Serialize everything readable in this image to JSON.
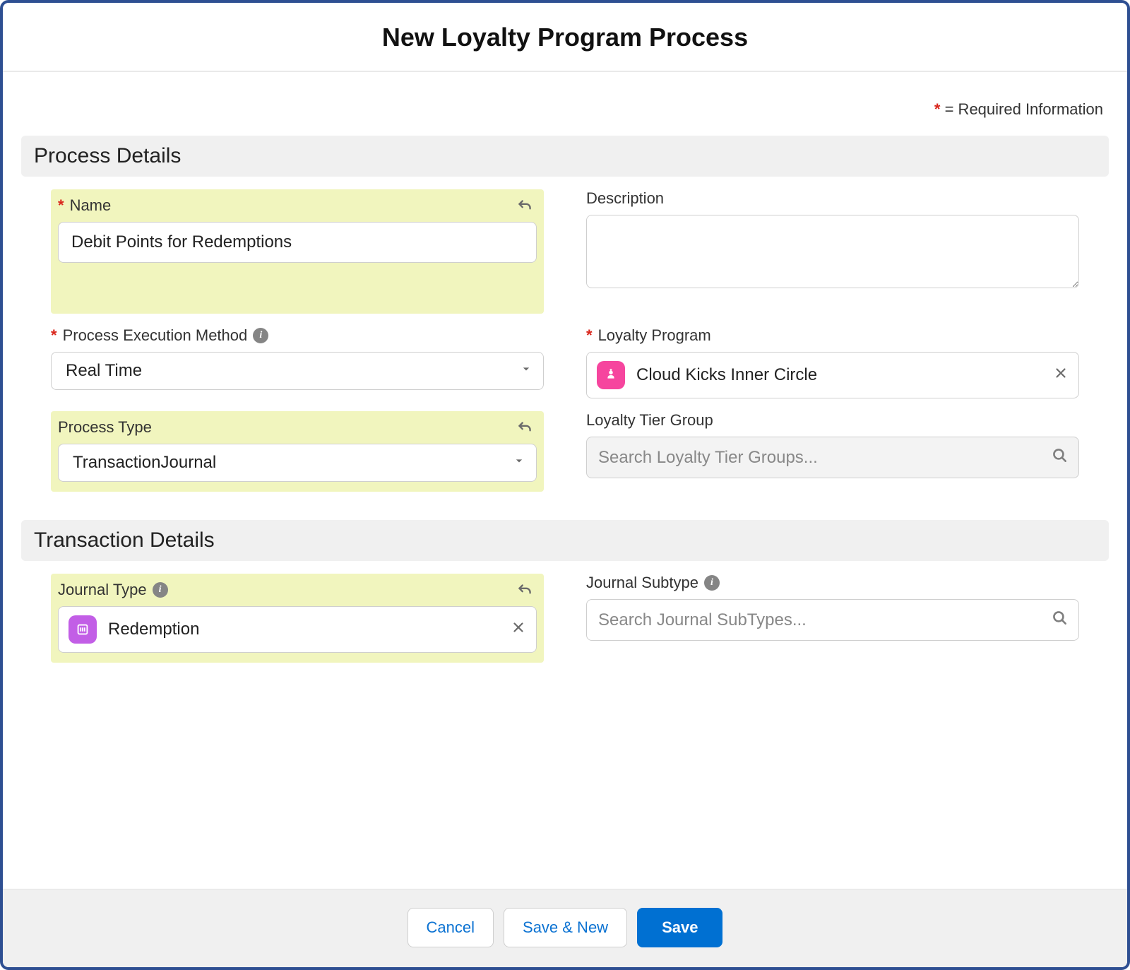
{
  "title": "New Loyalty Program Process",
  "required_note": "= Required Information",
  "sections": {
    "process": "Process Details",
    "transaction": "Transaction Details"
  },
  "fields": {
    "name": {
      "label": "Name",
      "value": "Debit Points for Redemptions",
      "required": true
    },
    "description": {
      "label": "Description",
      "value": ""
    },
    "exec_method": {
      "label": "Process Execution Method",
      "value": "Real Time",
      "required": true
    },
    "loyalty_program": {
      "label": "Loyalty Program",
      "value": "Cloud Kicks Inner Circle",
      "required": true
    },
    "process_type": {
      "label": "Process Type",
      "value": "TransactionJournal"
    },
    "tier_group": {
      "label": "Loyalty Tier Group",
      "placeholder": "Search Loyalty Tier Groups..."
    },
    "journal_type": {
      "label": "Journal Type",
      "value": "Redemption"
    },
    "journal_subtype": {
      "label": "Journal Subtype",
      "placeholder": "Search Journal SubTypes..."
    }
  },
  "footer": {
    "cancel": "Cancel",
    "save_new": "Save & New",
    "save": "Save"
  }
}
